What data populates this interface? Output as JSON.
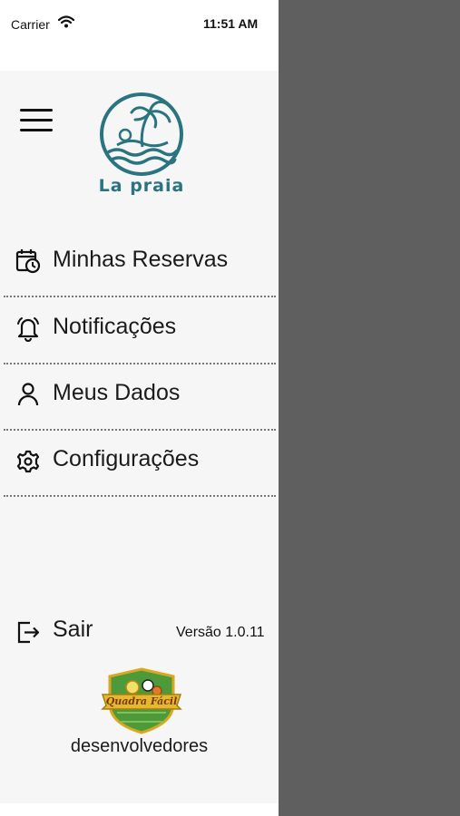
{
  "status_bar": {
    "carrier": "Carrier",
    "time": "11:51 AM"
  },
  "brand": {
    "logo_text": "La praia"
  },
  "menu": {
    "items": [
      {
        "label": "Minhas Reservas",
        "icon": "calendar-clock-icon"
      },
      {
        "label": "Notificações",
        "icon": "bell-icon"
      },
      {
        "label": "Meus Dados",
        "icon": "person-icon"
      },
      {
        "label": "Configurações",
        "icon": "gear-icon"
      }
    ]
  },
  "footer": {
    "logout_label": "Sair",
    "version": "Versão 1.0.11",
    "badge_text": "Quadra Fácil",
    "developers_label": "desenvolvedores"
  },
  "colors": {
    "brand": "#2a7480",
    "drawer_bg": "#f6f6f6",
    "overlay": "#5f5f5f",
    "badge_gold": "#e5b830",
    "badge_green": "#4e9a3a"
  }
}
